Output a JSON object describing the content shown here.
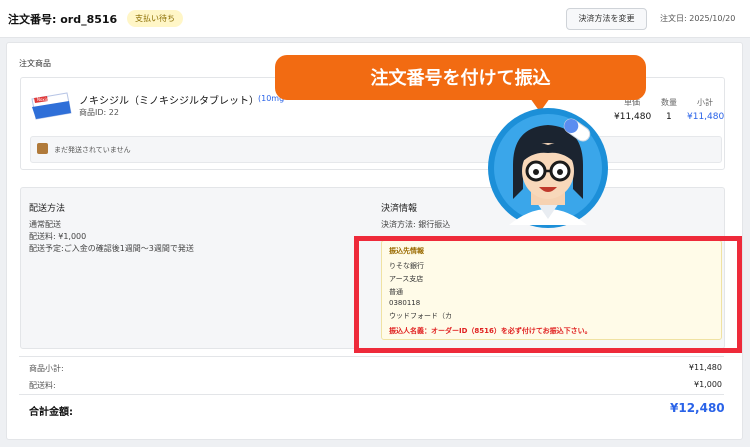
{
  "header": {
    "order_title": "注文番号: ord_8516",
    "status": "支払い待ち",
    "change_payment_label": "決済方法を変更",
    "order_date": "注文日: 2025/10/20"
  },
  "products": {
    "section_title": "注文商品",
    "item": {
      "name": "ノキシジル（ミノキシジルタブレット）",
      "tag": "(10mg",
      "id_label": "商品ID: 22",
      "unit_price_label": "単価",
      "qty_label": "数量",
      "subtotal_label": "小計",
      "unit_price": "¥11,480",
      "qty": "1",
      "subtotal": "¥11,480",
      "package_label": "Noxidil Forte"
    },
    "ship_note": "まだ発送されていません"
  },
  "shipping": {
    "title": "配送方法",
    "method": "通常配送",
    "fee": "配送料: ¥1,000",
    "schedule": "配送予定:ご入金の確認後1週間〜3週間で発送"
  },
  "payment": {
    "title": "決済情報",
    "method": "決済方法: 銀行振込",
    "bank": {
      "title": "振込先情報",
      "bank_name": "りそな銀行",
      "branch": "アース支店",
      "type": "普通",
      "number": "0380118",
      "holder": "ウッドフォード（カ",
      "warning": "振込人名義：オーダーID（8516）を必ず付けてお振込下さい。"
    }
  },
  "totals": {
    "subtotal_label": "商品小計:",
    "subtotal": "¥11,480",
    "shipping_label": "配送料:",
    "shipping": "¥1,000",
    "grand_label": "合計金額:",
    "grand": "¥12,480"
  },
  "callout": {
    "text": "注文番号を付けて振込"
  },
  "colors": {
    "accent_blue": "#2a63e8",
    "callout_orange": "#f26b12",
    "highlight_red": "#ee2a3a",
    "badge_yellow": "#fff6c7"
  }
}
